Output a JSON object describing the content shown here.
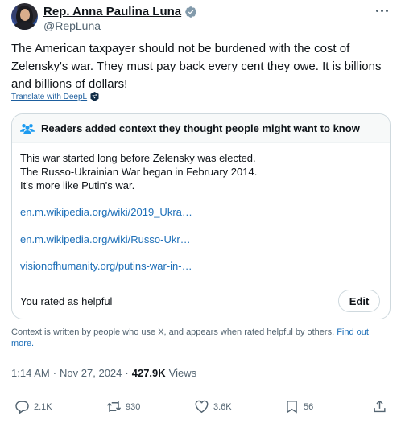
{
  "author": {
    "display_name": "Rep. Anna Paulina Luna",
    "handle": "@RepLuna",
    "verified_badge_color": "#829aab"
  },
  "tweet": {
    "text": "The American taxpayer should not be burdened with the cost of Zelensky's war. They must pay back every cent they owe. It is billions and billions of dollars!",
    "translate_label": "Translate with DeepL"
  },
  "community_note": {
    "header": "Readers added context they thought people might want to know",
    "body_lines": [
      "This war started long before Zelensky was elected.",
      "The Russo-Ukrainian War began in February 2014.",
      "It's more like Putin's war."
    ],
    "links": [
      "en.m.wikipedia.org/wiki/2019_Ukra…",
      "en.m.wikipedia.org/wiki/Russo-Ukr…",
      "visionofhumanity.org/putins-war-in-…"
    ],
    "rated_text": "You rated as helpful",
    "edit_label": "Edit"
  },
  "disclaimer": {
    "text": "Context is written by people who use X, and appears when rated helpful by others.",
    "link": "Find out more."
  },
  "meta": {
    "time": "1:14 AM",
    "separator": "·",
    "date": "Nov 27, 2024",
    "views_count": "427.9K",
    "views_label": "Views"
  },
  "actions": {
    "replies": "2.1K",
    "reposts": "930",
    "likes": "3.6K",
    "bookmarks": "56"
  },
  "icons": {
    "more": "more-dots-icon",
    "verified": "verified-badge-icon",
    "translate": "deepl-icon",
    "note": "people-icon",
    "reply": "reply-icon",
    "repost": "repost-icon",
    "like": "heart-icon",
    "bookmark": "bookmark-icon",
    "share": "share-icon"
  },
  "colors": {
    "link": "#1d6fb8",
    "secondary_text": "#536471",
    "border": "#cfd9de"
  }
}
